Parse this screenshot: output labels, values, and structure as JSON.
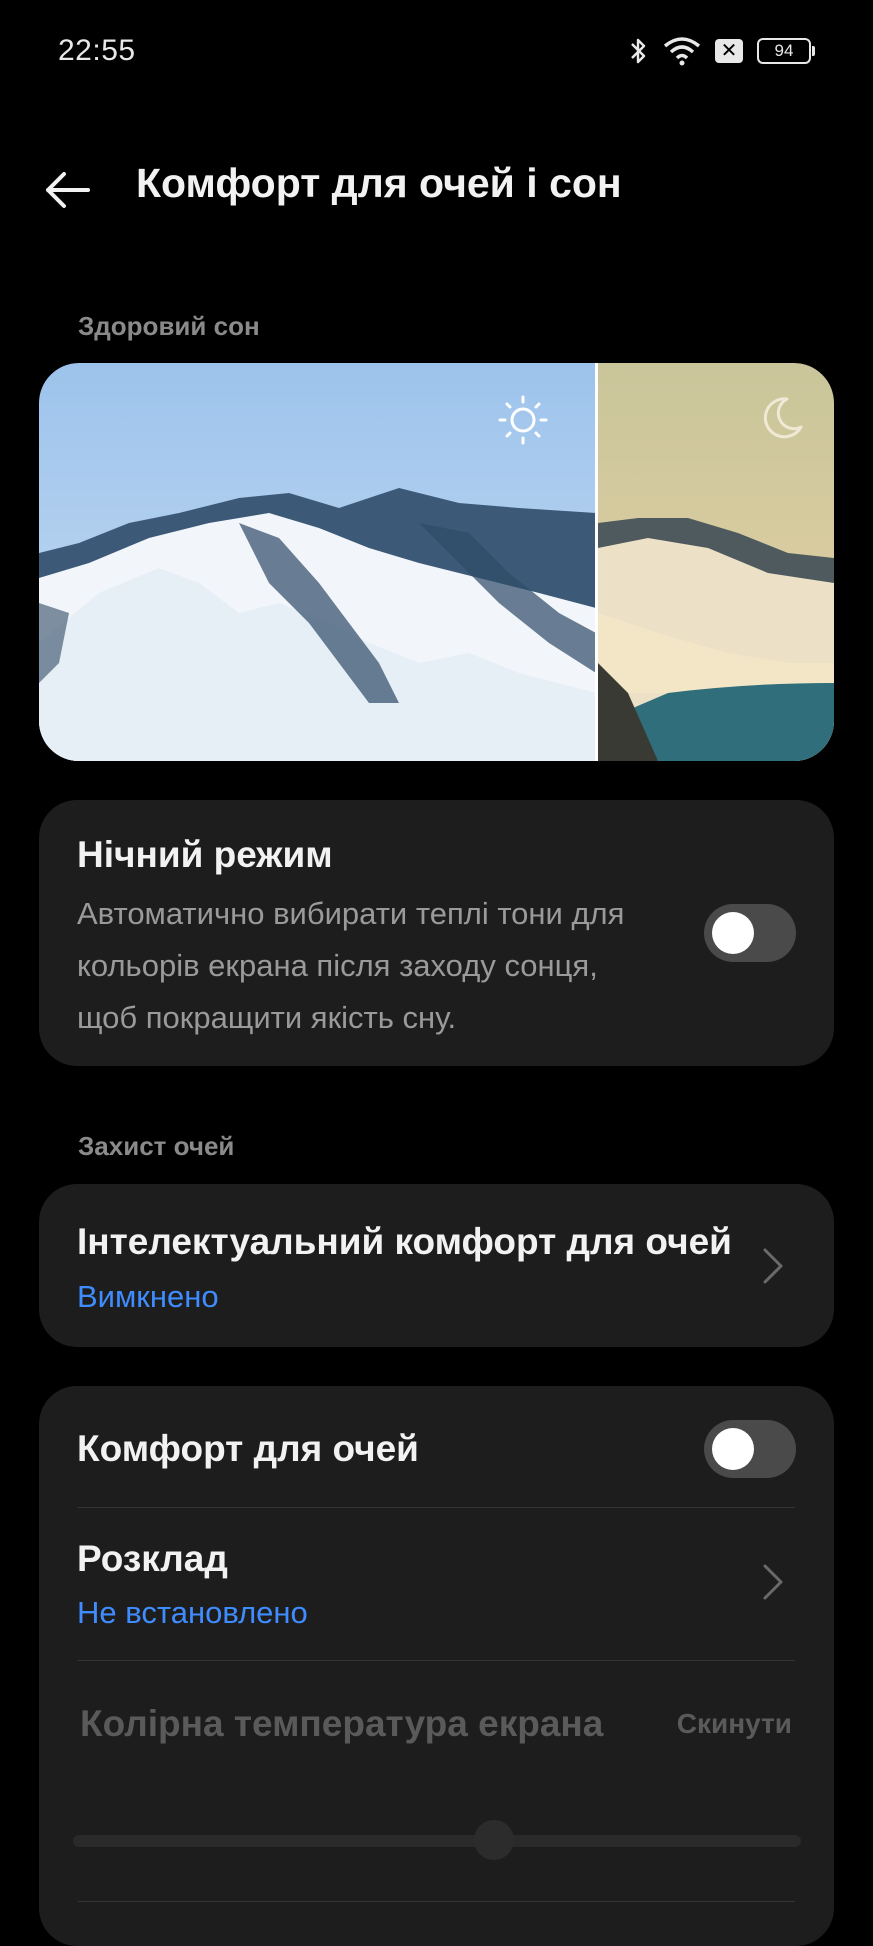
{
  "status_bar": {
    "time": "22:55",
    "battery": "94",
    "icons": [
      "bluetooth-icon",
      "wifi-icon",
      "sim-off-icon",
      "battery-icon"
    ]
  },
  "header": {
    "title": "Комфорт для очей і сон"
  },
  "sleep_section": {
    "label": "Здоровий сон",
    "night_mode": {
      "title": "Нічний режим",
      "description": "Автоматично вибирати теплі тони для кольорів екрана після заходу сонця, щоб покращити якість сну.",
      "enabled": false
    }
  },
  "eye_section": {
    "label": "Захист очей",
    "smart_comfort": {
      "title": "Інтелектуальний комфорт для очей",
      "status": "Вимкнено"
    },
    "eye_comfort": {
      "title": "Комфорт для очей",
      "enabled": false
    },
    "schedule": {
      "title": "Розклад",
      "status": "Не встановлено"
    },
    "color_temperature": {
      "title": "Колірна температура екрана",
      "reset_label": "Скинути",
      "value": 0.5
    }
  },
  "colors": {
    "background": "#000000",
    "card": "#1d1d1d",
    "accent": "#3f8cff",
    "secondary_text": "#9a9a9a"
  }
}
